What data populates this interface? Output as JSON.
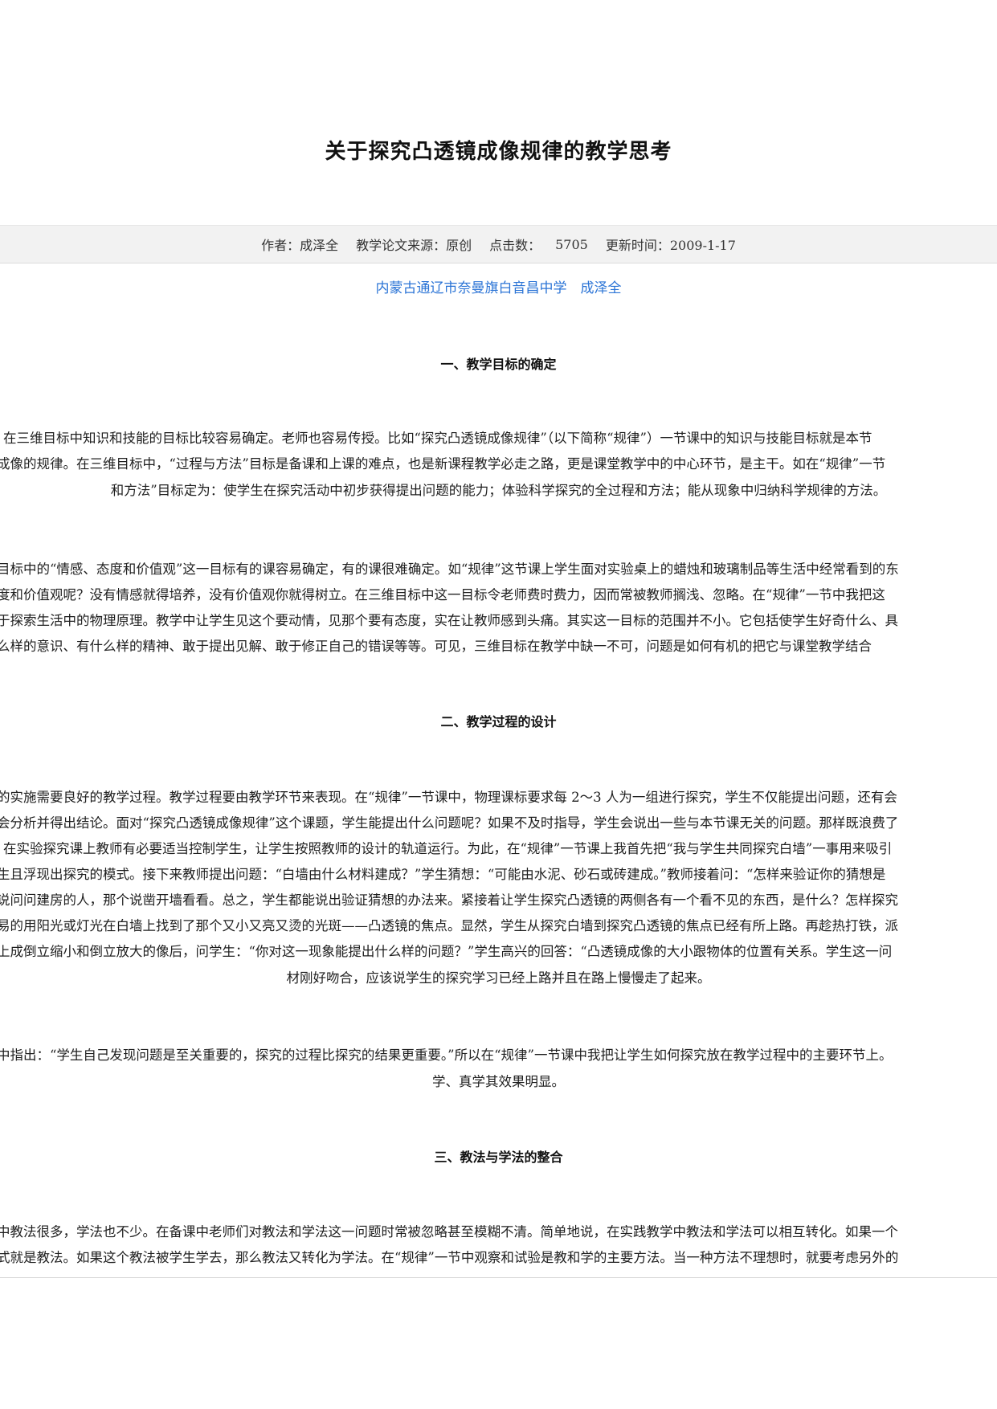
{
  "article": {
    "title": "关于探究凸透镜成像规律的教学思考",
    "meta": {
      "author": "作者：成泽全",
      "source": "教学论文来源：原创",
      "clicks_label": "点击数：",
      "clicks": "5705",
      "updated": "更新时间：2009-1-17"
    },
    "school_author": "内蒙古通辽市奈曼旗白音昌中学　成泽全",
    "sections": [
      {
        "heading": "一、教学目标的确定"
      },
      {
        "heading": "二、教学过程的设计"
      },
      {
        "heading": "三、教法与学法的整合"
      }
    ],
    "paragraphs": [
      {
        "lines": [
          "在三维目标中知识和技能的目标比较容易确定。老师也容易传授。比如“探究凸透镜成像规律”（以下简称“规律”）一节课中的知识与技能目标就是本节",
          "成像的规律。在三维目标中，“过程与方法”目标是备课和上课的难点，也是新课程教学必走之路，更是课堂教学中的中心环节，是主干。如在“规律”一节",
          "和方法”目标定为：使学生在探究活动中初步获得提出问题的能力；体验科学探究的全过程和方法；能从现象中归纳科学规律的方法。"
        ]
      },
      {
        "lines": [
          "目标中的“情感、态度和价值观”这一目标有的课容易确定，有的课很难确定。如“规律”这节课上学生面对实验桌上的蜡烛和玻璃制品等生活中经常看到的东",
          "度和价值观呢？没有情感就得培养，没有价值观你就得树立。在三维目标中这一目标令老师费时费力，因而常被教师搁浅、忽略。在“规律”一节中我把这",
          "于探索生活中的物理原理。教学中让学生见这个要动情，见那个要有态度，实在让教师感到头痛。其实这一目标的范围并不小。它包括使学生好奇什么、具",
          "么样的意识、有什么样的精神、敢于提出见解、敢于修正自己的错误等等。可见，三维目标在教学中缺一不可，问题是如何有机的把它与课堂教学结合"
        ]
      },
      {
        "lines": [
          "的实施需要良好的教学过程。教学过程要由教学环节来表现。在“规律”一节课中，物理课标要求每 2～3 人为一组进行探究，学生不仅能提出问题，还有会",
          "会分析并得出结论。面对“探究凸透镜成像规律”这个课题，学生能提出什么问题呢？如果不及时指导，学生会说出一些与本节课无关的问题。那样既浪费了",
          "在实验探究课上教师有必要适当控制学生，让学生按照教师的设计的轨道运行。为此，在“规律”一节课上我首先把“我与学生共同探究白墙”一事用来吸引",
          "生且浮现出探究的模式。接下来教师提出问题：“白墙由什么材料建成？”学生猜想：“可能由水泥、砂石或砖建成。”教师接着问：“怎样来验证你的猜想是",
          "说问问建房的人，那个说凿开墙看看。总之，学生都能说出验证猜想的办法来。紧接着让学生探究凸透镜的两侧各有一个看不见的东西，是什么？怎样探究",
          "易的用阳光或灯光在白墙上找到了那个又小又亮又烫的光斑——凸透镜的焦点。显然，学生从探究白墙到探究凸透镜的焦点已经有所上路。再趁热打铁，派",
          "上成倒立缩小和倒立放大的像后，问学生：“你对这一现象能提出什么样的问题？”学生高兴的回答：“凸透镜成像的大小跟物体的位置有关系。学生这一问",
          "材刚好吻合，应该说学生的探究学习已经上路并且在路上慢慢走了起来。"
        ]
      },
      {
        "lines": [
          "中指出：“学生自己发现问题是至关重要的，探究的过程比探究的结果更重要。”所以在“规律”一节课中我把让学生如何探究放在教学过程中的主要环节上。",
          "学、真学其效果明显。"
        ]
      },
      {
        "lines": [
          "中教法很多，学法也不少。在备课中老师们对教法和学法这一问题时常被忽略甚至模糊不清。简单地说，在实践教学中教法和学法可以相互转化。如果一个",
          "式就是教法。如果这个教法被学生学去，那么教法又转化为学法。在“规律”一节中观察和试验是教和学的主要方法。当一种方法不理想时，就要考虑另外的"
        ]
      }
    ]
  }
}
